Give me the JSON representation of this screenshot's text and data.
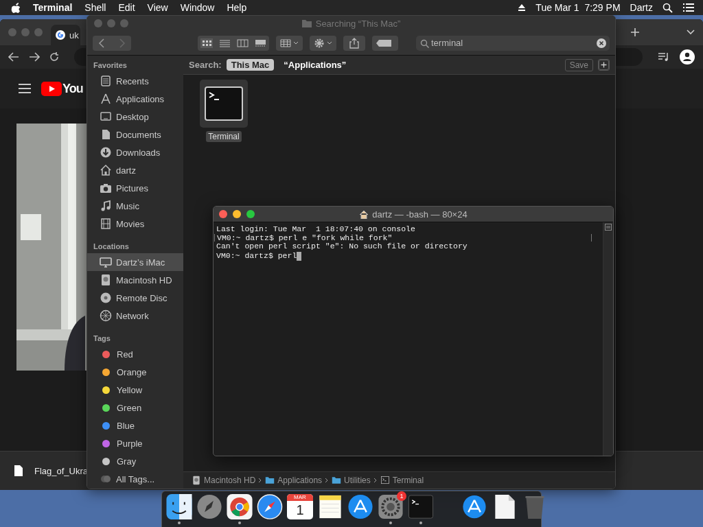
{
  "menu_bar": {
    "app_name": "Terminal",
    "menus": [
      "Shell",
      "Edit",
      "View",
      "Window",
      "Help"
    ],
    "clock": "Tue Mar 1  7:29 PM",
    "user": "Dartz"
  },
  "browser": {
    "tab_title": "uk",
    "logo_text": "You",
    "download": "Flag_of_Ukra"
  },
  "finder": {
    "title": "Searching “This Mac”",
    "search_value": "terminal",
    "scope_label": "Search:",
    "scopes": [
      {
        "label": "This Mac",
        "selected": true
      },
      {
        "label": "“Applications”",
        "selected": false
      }
    ],
    "save_label": "Save",
    "sections": [
      {
        "heading": "Favorites",
        "items": [
          {
            "label": "Recents",
            "kind": "recents",
            "selected": false
          },
          {
            "label": "Applications",
            "kind": "applications",
            "selected": false
          },
          {
            "label": "Desktop",
            "kind": "desktop",
            "selected": false
          },
          {
            "label": "Documents",
            "kind": "documents",
            "selected": false
          },
          {
            "label": "Downloads",
            "kind": "downloads",
            "selected": false
          },
          {
            "label": "dartz",
            "kind": "home",
            "selected": false
          },
          {
            "label": "Pictures",
            "kind": "pictures",
            "selected": false
          },
          {
            "label": "Music",
            "kind": "music",
            "selected": false
          },
          {
            "label": "Movies",
            "kind": "movies",
            "selected": false
          }
        ]
      },
      {
        "heading": "Locations",
        "items": [
          {
            "label": "Dartz’s iMac",
            "kind": "computer",
            "selected": true
          },
          {
            "label": "Macintosh HD",
            "kind": "disk",
            "selected": false
          },
          {
            "label": "Remote Disc",
            "kind": "disc",
            "selected": false
          },
          {
            "label": "Network",
            "kind": "network",
            "selected": false
          }
        ]
      },
      {
        "heading": "Tags",
        "items": [
          {
            "label": "Red",
            "kind": "tag",
            "color": "#ec5b5b",
            "selected": false
          },
          {
            "label": "Orange",
            "kind": "tag",
            "color": "#f5a733",
            "selected": false
          },
          {
            "label": "Yellow",
            "kind": "tag",
            "color": "#f5d83a",
            "selected": false
          },
          {
            "label": "Green",
            "kind": "tag",
            "color": "#5ad65a",
            "selected": false
          },
          {
            "label": "Blue",
            "kind": "tag",
            "color": "#3d8ff5",
            "selected": false
          },
          {
            "label": "Purple",
            "kind": "tag",
            "color": "#c065e6",
            "selected": false
          },
          {
            "label": "Gray",
            "kind": "tag",
            "color": "#c4c4c4",
            "selected": false
          },
          {
            "label": "All Tags...",
            "kind": "all-tags",
            "selected": false
          }
        ]
      }
    ],
    "results": [
      {
        "label": "Terminal",
        "selected": true
      }
    ],
    "path": [
      {
        "label": "Macintosh HD",
        "kind": "disk"
      },
      {
        "label": "Applications",
        "kind": "folder"
      },
      {
        "label": "Utilities",
        "kind": "folder"
      },
      {
        "label": "Terminal",
        "kind": "terminal"
      }
    ]
  },
  "terminal": {
    "title": "dartz — -bash — 80×24",
    "lines": [
      {
        "text": "Last login: Tue Mar  1 18:07:40 on console",
        "bracketed": false,
        "cursor": false
      },
      {
        "text": "VM0:~ dartz$ perl e \"fork while fork\"",
        "bracketed": true,
        "cursor": false
      },
      {
        "text": "Can't open perl script \"e\": No such file or directory",
        "bracketed": false,
        "cursor": false
      },
      {
        "text": "VM0:~ dartz$ perl",
        "bracketed": false,
        "cursor": true
      }
    ]
  },
  "dock": [
    {
      "kind": "finder",
      "running": true
    },
    {
      "kind": "launchpad",
      "running": false
    },
    {
      "kind": "chrome",
      "running": true
    },
    {
      "kind": "safari",
      "running": false
    },
    {
      "kind": "calendar",
      "month": "MAR",
      "day": "1",
      "running": false
    },
    {
      "kind": "notes",
      "running": false
    },
    {
      "kind": "app-store",
      "running": false
    },
    {
      "kind": "system-preferences",
      "badge": "1",
      "running": true
    },
    {
      "kind": "terminal",
      "running": true
    },
    {
      "kind": "separator"
    },
    {
      "kind": "downloads-stack",
      "running": false
    },
    {
      "kind": "document",
      "running": false
    },
    {
      "kind": "trash",
      "running": false
    }
  ]
}
